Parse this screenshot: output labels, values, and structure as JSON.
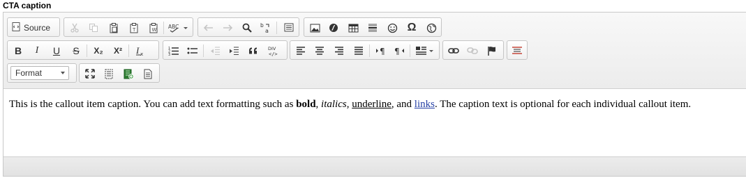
{
  "field": {
    "label": "CTA caption"
  },
  "toolbar": {
    "source_label": "Source",
    "format_label": "Format",
    "row1": {
      "cut": "scissors-icon",
      "copy": "copy-icon",
      "paste": "paste-icon",
      "paste_text": "paste-text-icon",
      "paste_word": "paste-word-icon",
      "spellcheck": "ABC",
      "undo": "undo-icon",
      "redo": "redo-icon",
      "find": "search-icon",
      "replace": "replace-icon",
      "select_all": "select-all-icon",
      "image": "image-icon",
      "flash": "flash-icon",
      "table": "table-icon",
      "hr": "horizontal-line-icon",
      "smiley": "smiley-icon",
      "special_char": "Ω",
      "iframe": "globe-icon"
    },
    "row2": {
      "bold": "B",
      "italic": "I",
      "underline": "U",
      "strike": "S",
      "subscript": "X₂",
      "superscript": "X²",
      "remove_format": "Ix",
      "ordered_list": "ordered-list-icon",
      "bulleted_list": "bulleted-list-icon",
      "outdent": "outdent-icon",
      "indent": "indent-icon",
      "blockquote": "99",
      "div": "DIV",
      "align_left": "align-left-icon",
      "align_center": "align-center-icon",
      "align_right": "align-right-icon",
      "justify": "justify-icon",
      "ltr": "ltr-icon",
      "rtl": "rtl-icon",
      "language": "language-icon",
      "link": "link-icon",
      "unlink": "unlink-icon",
      "anchor": "flag-icon",
      "show_blocks": "show-blocks-icon"
    },
    "row3": {
      "maximize": "maximize-icon",
      "show_blocks": "blocks-icon",
      "media": "media-embed-icon",
      "templates": "document-icon"
    }
  },
  "content": {
    "t1": "This is the callout item caption. You can add text formatting such as ",
    "bold": "bold",
    "t2": ", ",
    "italic": "italics",
    "t3": ", ",
    "underline": "underline",
    "t4": ", and ",
    "link": "links",
    "t5": ". The caption text is optional for each individual callout item."
  },
  "colors": {
    "link": "#2540a6",
    "toolbar_bg": "#ececec"
  }
}
